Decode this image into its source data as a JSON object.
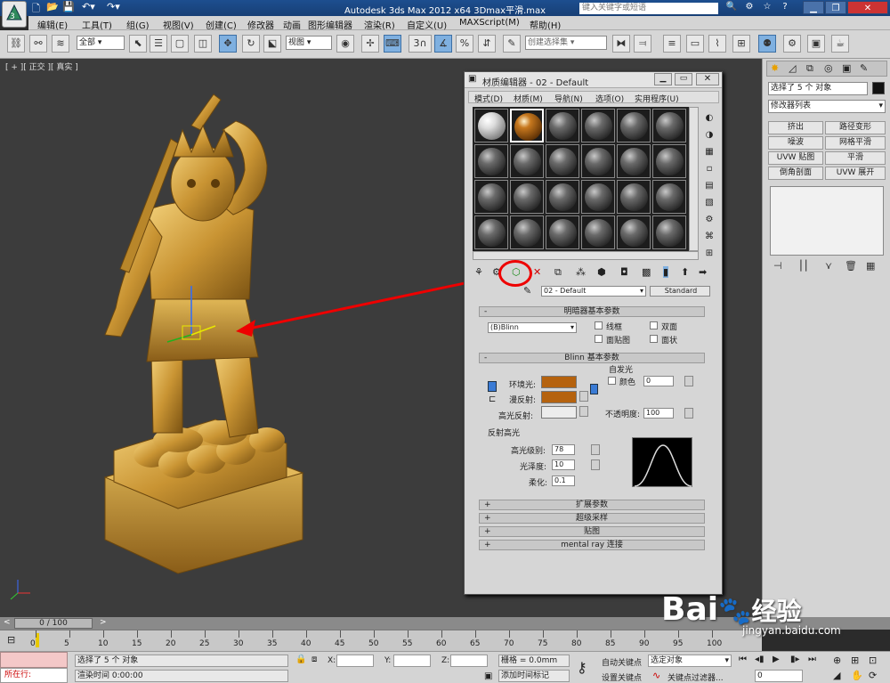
{
  "window": {
    "title": "Autodesk 3ds Max  2012 x64     3Dmax平滑.max",
    "search_placeholder": "键入关键字或短语"
  },
  "menu": [
    "编辑(E)",
    "工具(T)",
    "组(G)",
    "视图(V)",
    "创建(C)",
    "修改器",
    "动画",
    "图形编辑器",
    "渲染(R)",
    "自定义(U)",
    "MAXScript(M)",
    "帮助(H)"
  ],
  "toolbar": {
    "filter_select": "全部",
    "refcoord_select": "视图",
    "number_label": "3",
    "selection_set_placeholder": "创建选择集"
  },
  "viewport": {
    "label": "[ + ][ 正交 ][ 真实 ]"
  },
  "command_panel": {
    "selection_text": "选择了 5 个 对象",
    "modifier_list": "修改器列表",
    "modifier_buttons": [
      "挤出",
      "路径变形",
      "噪波",
      "网格平滑",
      "UVW 贴图",
      "平滑",
      "倒角剖面",
      "UVW 展开"
    ]
  },
  "material_editor": {
    "title": "材质编辑器 - 02 - Default",
    "menu": [
      "模式(D)",
      "材质(M)",
      "导航(N)",
      "选项(O)",
      "实用程序(U)"
    ],
    "material_name": "02 - Default",
    "material_type": "Standard",
    "shader_rollout": "明暗器基本参数",
    "shader_select": "(B)Blinn",
    "shader_options": [
      "线框",
      "双面",
      "面贴图",
      "面状"
    ],
    "blinn_rollout": "Blinn 基本参数",
    "self_illum_label": "自发光",
    "self_illum_color_label": "颜色",
    "self_illum_value": "0",
    "ambient_label": "环境光:",
    "diffuse_label": "漫反射:",
    "specular_label": "高光反射:",
    "opacity_label": "不透明度:",
    "opacity_value": "100",
    "spec_highlights_label": "反射高光",
    "spec_level_label": "高光级别:",
    "spec_level_value": "78",
    "glossiness_label": "光泽度:",
    "glossiness_value": "10",
    "soften_label": "柔化:",
    "soften_value": "0.1",
    "rollouts_collapsed": [
      "扩展参数",
      "超级采样",
      "贴图",
      "mental ray 连接"
    ],
    "ambient_color": "#b5620e",
    "diffuse_color": "#b5620e",
    "specular_color": "#ececec"
  },
  "timeline": {
    "frame_label": "0 / 100",
    "ticks": [
      "0",
      "5",
      "10",
      "15",
      "20",
      "25",
      "30",
      "35",
      "40",
      "45",
      "50",
      "55",
      "60",
      "65",
      "70",
      "75",
      "80",
      "85",
      "90",
      "95",
      "100"
    ]
  },
  "status": {
    "location": "所在行:",
    "selected": "选择了 5 个 对象",
    "render_time": "渲染时间  0:00:00",
    "x_label": "X:",
    "y_label": "Y:",
    "z_label": "Z:",
    "grid": "栅格 = 0.0mm",
    "auto_key": "自动关键点",
    "set_key": "设置关键点",
    "selected_object": "选定对象",
    "key_filters": "关键点过滤器...",
    "add_time_tag": "添加时间标记",
    "frame_field": "0"
  },
  "watermark": {
    "brand": "Bai",
    "brand_cn": "经验",
    "url": "jingyan.baidu.com"
  }
}
